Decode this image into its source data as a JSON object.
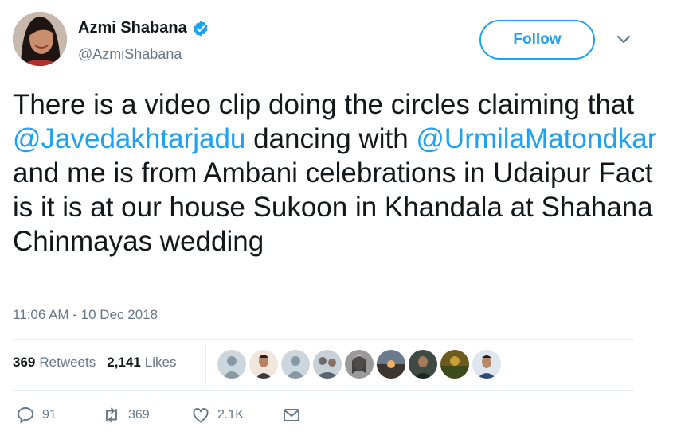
{
  "profile": {
    "display_name": "Azmi Shabana",
    "handle": "@AzmiShabana",
    "verified_icon": "verified-badge-icon",
    "avatar_icon": "profile-photo"
  },
  "header": {
    "follow_label": "Follow",
    "more_icon": "chevron-down-icon"
  },
  "tweet": {
    "t1": "There is a video clip doing the circles claiming that ",
    "mention1": "@Javedakhtarjadu",
    "t2": " dancing with ",
    "mention2": "@UrmilaMatondkar",
    "t3": " and me is from Ambani celebrations in Udaipur Fact is it is at our house Sukoon in Khandala at Shahana Chinmayas wedding"
  },
  "timestamp": "11:06 AM - 10 Dec 2018",
  "stats": {
    "retweets_count": "369",
    "retweets_label": "Retweets",
    "likes_count": "2,141",
    "likes_label": "Likes"
  },
  "actions": {
    "reply_count": "91",
    "retweet_count": "369",
    "like_count": "2.1K",
    "reply_icon": "reply-icon",
    "retweet_icon": "retweet-icon",
    "like_icon": "heart-icon",
    "message_icon": "envelope-icon"
  },
  "colors": {
    "accent": "#1da1f2",
    "text": "#14171a",
    "muted": "#657786",
    "divider": "#e6ecf0"
  }
}
